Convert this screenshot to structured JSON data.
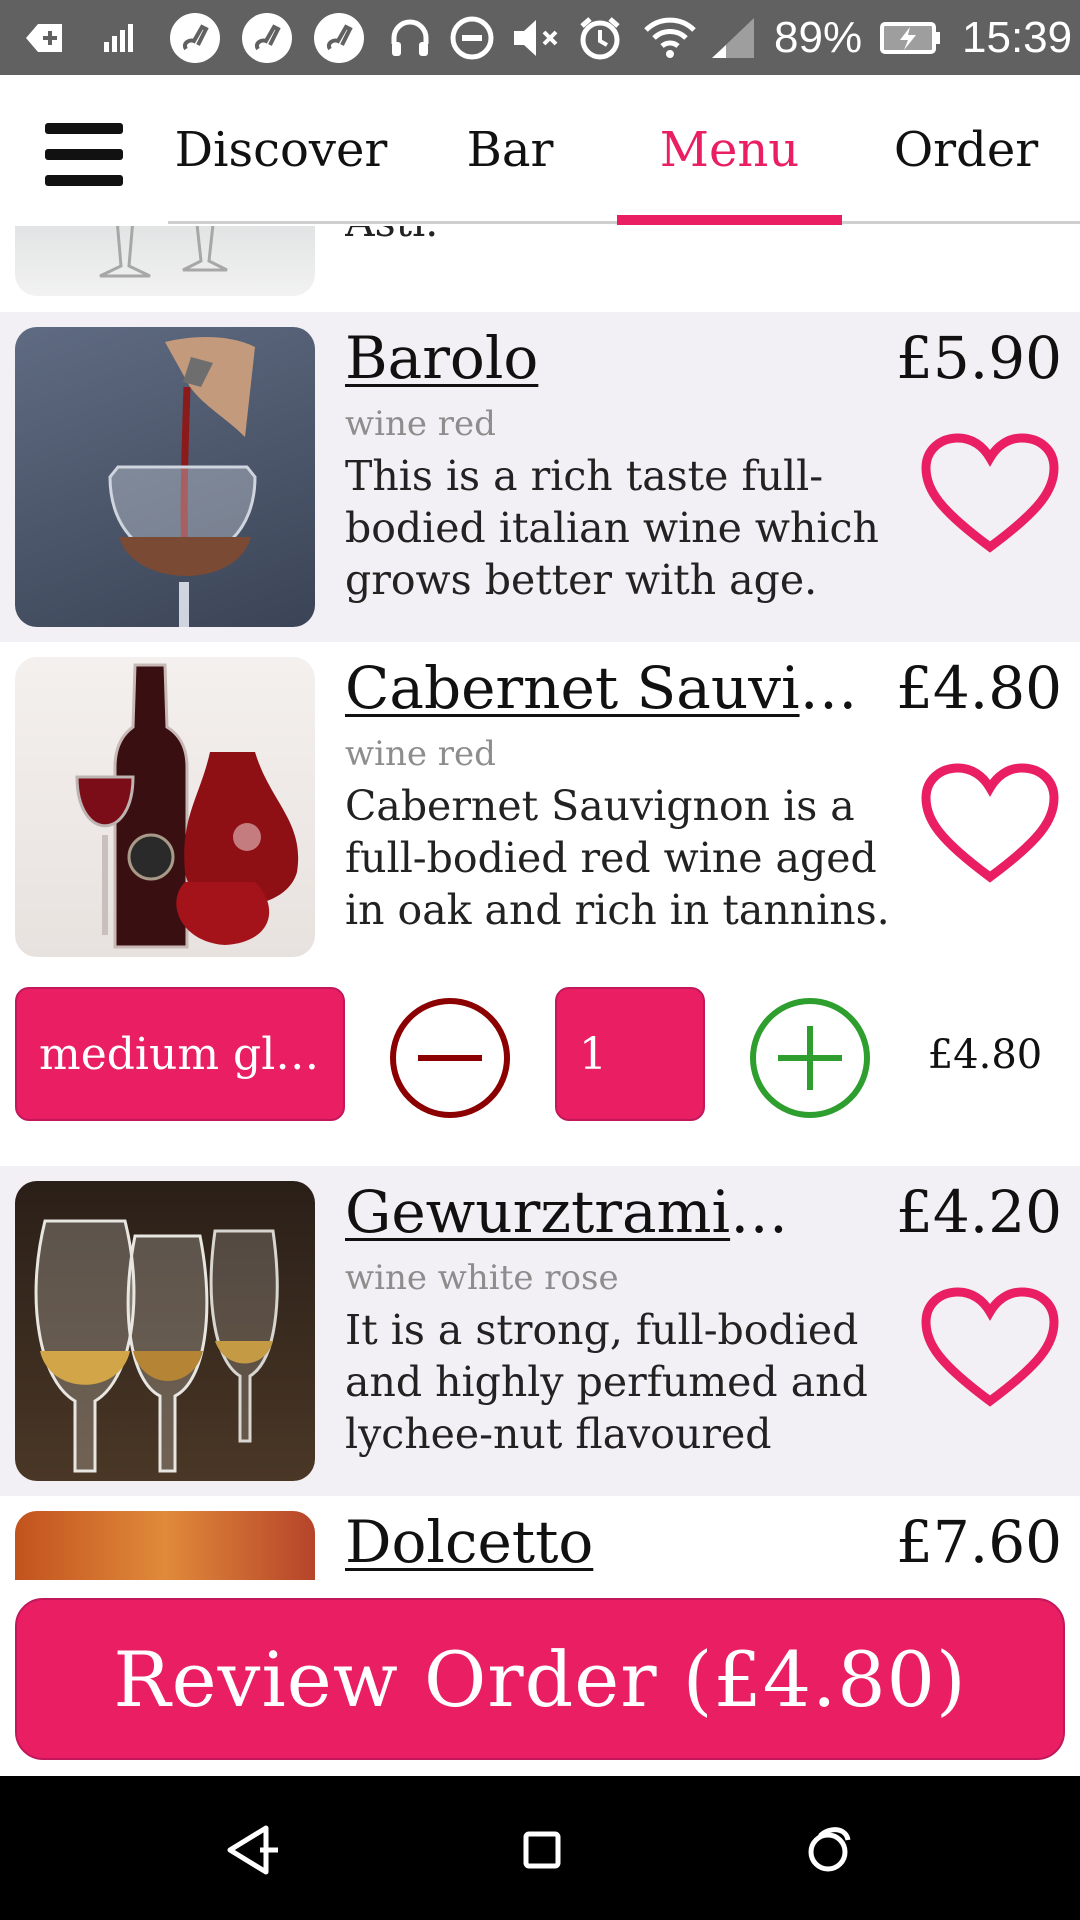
{
  "status_bar": {
    "battery": "89%",
    "time": "15:39"
  },
  "tabs": [
    {
      "label": "Discover",
      "active": false
    },
    {
      "label": "Bar",
      "active": false
    },
    {
      "label": "Menu",
      "active": true
    },
    {
      "label": "Order",
      "active": false
    }
  ],
  "items": [
    {
      "title": "",
      "price": "",
      "category": "",
      "description": "Asti."
    },
    {
      "title": "Barolo",
      "price": "£5.90",
      "category": "wine red",
      "description": "This is a rich taste full-bodied italian wine which grows better with age."
    },
    {
      "title": "Cabernet Sauvign…",
      "price": "£4.80",
      "category": "wine red",
      "description": "Cabernet Sauvignon is a full-bodied red wine aged in oak and rich in tannins."
    },
    {
      "title": "Gewurztraminer",
      "price": "£4.20",
      "category": "wine white rose",
      "description": "It is a strong, full-bodied and highly perfumed and lychee-nut flavoured white…"
    },
    {
      "title": "Dolcetto",
      "price": "£7.60",
      "category": "",
      "description": ""
    }
  ],
  "order_controls": {
    "size_select": "medium gl…",
    "quantity": "1",
    "line_total": "£4.80"
  },
  "review_button": {
    "label": "Review Order  (£4.80)"
  },
  "colors": {
    "accent": "#e91e63",
    "minus": "#8b0000",
    "plus": "#2e9e2e"
  },
  "icons": [
    "menu-icon",
    "heart-icon",
    "minus-icon",
    "plus-icon",
    "back-icon",
    "home-icon",
    "recents-icon"
  ]
}
